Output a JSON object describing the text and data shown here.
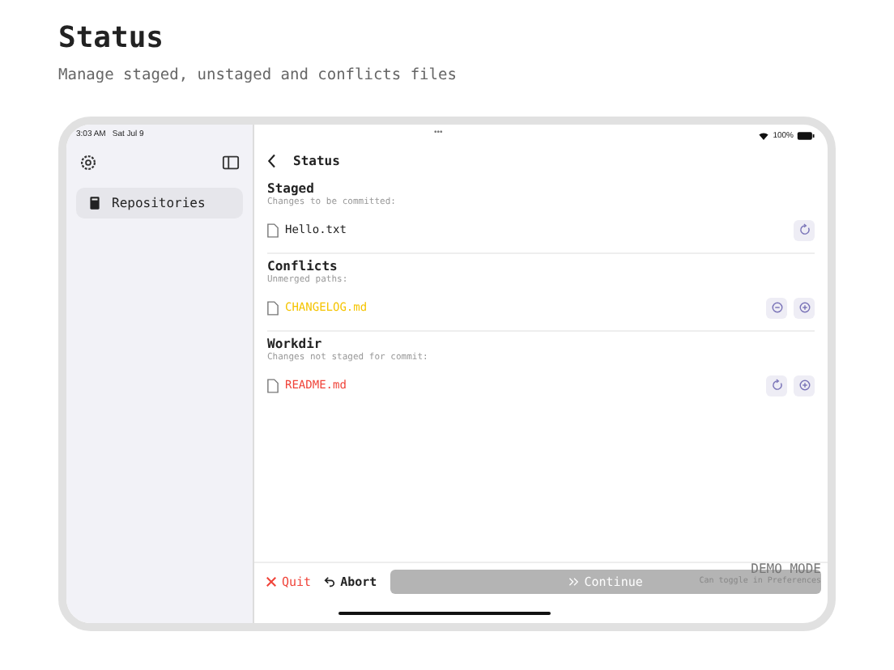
{
  "page": {
    "title": "Status",
    "subtitle": "Manage staged, unstaged and conflicts files"
  },
  "status_bar": {
    "time": "3:03 AM",
    "date": "Sat Jul 9",
    "dots": "•••",
    "battery": "100%"
  },
  "sidebar": {
    "items": [
      {
        "label": "Repositories",
        "selected": true
      }
    ]
  },
  "nav": {
    "title": "Status"
  },
  "sections": [
    {
      "title": "Staged",
      "subtitle": "Changes to be committed:",
      "files": [
        {
          "name": "Hello.txt",
          "color": "#222222",
          "actions": [
            {
              "kind": "restore"
            }
          ]
        }
      ]
    },
    {
      "title": "Conflicts",
      "subtitle": "Unmerged paths:",
      "files": [
        {
          "name": "CHANGELOG.md",
          "color": "#f5c400",
          "actions": [
            {
              "kind": "minus"
            },
            {
              "kind": "plus"
            }
          ]
        }
      ]
    },
    {
      "title": "Workdir",
      "subtitle": "Changes not staged for commit:",
      "files": [
        {
          "name": "README.md",
          "color": "#f0443a",
          "actions": [
            {
              "kind": "restore"
            },
            {
              "kind": "plus"
            }
          ]
        }
      ]
    }
  ],
  "bottom_bar": {
    "quit": "Quit",
    "abort": "Abort",
    "continue": {
      "label": "Continue",
      "disabled": true
    }
  },
  "demo": {
    "title": "DEMO MODE",
    "note": "Can toggle in Preferences"
  }
}
